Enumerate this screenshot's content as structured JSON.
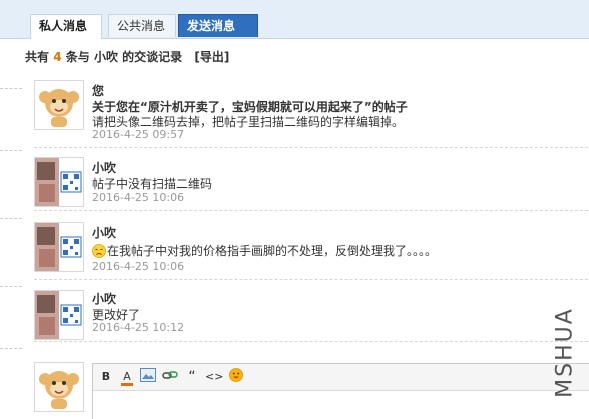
{
  "tabs": {
    "private": "私人消息",
    "public": "公共消息",
    "send": "发送消息"
  },
  "header": {
    "prefix": "共有",
    "count": "4",
    "middle": "条与",
    "user": "小吹",
    "suffix": "的交谈记录",
    "export": "[导出]"
  },
  "messages": [
    {
      "name": "您",
      "lines": [
        "关于您在“原汁机开卖了，宝妈假期就可以用起来了”的帖子",
        "请把头像二维码去掉，把帖子里扫描二维码的字样编辑掉。"
      ],
      "time": "2016-4-25 09:57",
      "avatar": "monkey-avatar"
    },
    {
      "name": "小吹",
      "lines": [
        "帖子中没有扫描二维码"
      ],
      "time": "2016-4-25 10:06",
      "avatar": "photo-qr-avatar"
    },
    {
      "name": "小吹",
      "lines": [
        "在我帖子中对我的价格指手画脚的不处理，反倒处理我了。。。。"
      ],
      "time": "2016-4-25 10:06",
      "avatar": "photo-qr-avatar"
    },
    {
      "name": "小吹",
      "lines": [
        "更改好了"
      ],
      "time": "2016-4-25 10:12",
      "avatar": "photo-qr-avatar"
    }
  ],
  "editor": {
    "tools": [
      "bold-icon",
      "font-color-icon",
      "image-icon",
      "link-icon",
      "quote-icon",
      "code-icon",
      "emoji-icon"
    ],
    "bold_label": "B",
    "color_label": "A",
    "quote_label": "“",
    "code_label": "<>"
  },
  "watermark": "MSHUA",
  "colors": {
    "tab_active_bg": "#2f6fc0",
    "count": "#e07000",
    "time": "#999999"
  }
}
